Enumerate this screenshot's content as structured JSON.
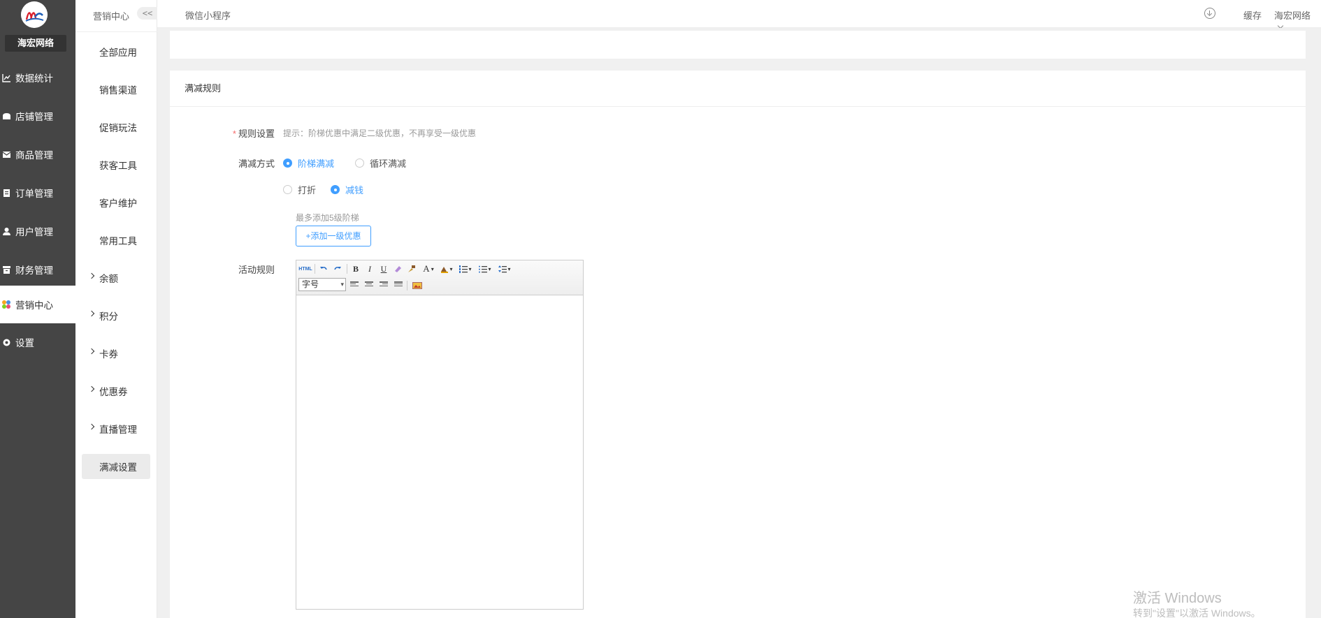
{
  "app": {
    "brand": "海宏网络"
  },
  "sidebar": {
    "items": [
      {
        "label": "数据统计",
        "icon": "chart-line-icon"
      },
      {
        "label": "店铺管理",
        "icon": "store-icon"
      },
      {
        "label": "商品管理",
        "icon": "box-icon"
      },
      {
        "label": "订单管理",
        "icon": "clipboard-icon"
      },
      {
        "label": "用户管理",
        "icon": "user-icon"
      },
      {
        "label": "财务管理",
        "icon": "archive-icon"
      },
      {
        "label": "营销中心",
        "icon": "marketing-icon",
        "active": true
      },
      {
        "label": "设置",
        "icon": "gear-icon"
      }
    ]
  },
  "submenu": {
    "title": "营销中心",
    "collapse": "<<",
    "items": [
      {
        "label": "全部应用"
      },
      {
        "label": "销售渠道"
      },
      {
        "label": "促销玩法"
      },
      {
        "label": "获客工具"
      },
      {
        "label": "客户维护"
      },
      {
        "label": "常用工具"
      },
      {
        "label": "余额",
        "expandable": true
      },
      {
        "label": "积分",
        "expandable": true
      },
      {
        "label": "卡券",
        "expandable": true
      },
      {
        "label": "优惠券",
        "expandable": true
      },
      {
        "label": "直播管理",
        "expandable": true
      },
      {
        "label": "满减设置",
        "active": true
      }
    ]
  },
  "topbar": {
    "title": "微信小程序",
    "cache": "缓存",
    "user": "海宏网络"
  },
  "card": {
    "header": "满减规则"
  },
  "form": {
    "rule_label": "规则设置",
    "rule_hint": "提示：阶梯优惠中满足二级优惠，不再享受一级优惠",
    "mode_label": "满减方式",
    "mode_options": [
      "阶梯满减",
      "循环满减"
    ],
    "mode_selected": "阶梯满减",
    "type_options": [
      "打折",
      "减钱"
    ],
    "type_selected": "减钱",
    "tier_hint": "最多添加5级阶梯",
    "add_tier_button": "+添加一级优惠",
    "activity_label": "活动规则"
  },
  "editor": {
    "html_button": "HTML",
    "font_size_placeholder": "字号",
    "font_color_glyph": "A"
  },
  "watermark": {
    "line1": "激活 Windows",
    "line2": "转到\"设置\"以激活 Windows。"
  },
  "colors": {
    "sidebar_bg": "#454545",
    "accent": "#409eff",
    "required": "#f56c6c"
  }
}
